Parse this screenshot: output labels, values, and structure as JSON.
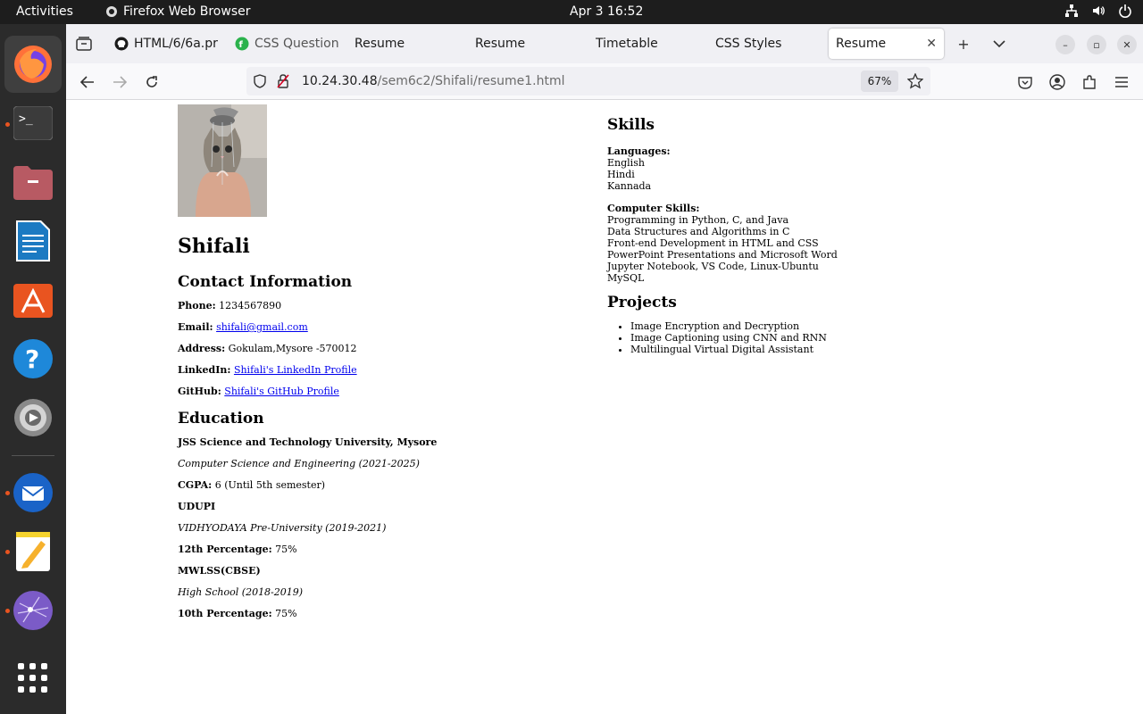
{
  "system": {
    "activities": "Activities",
    "app_name": "Firefox Web Browser",
    "clock": "Apr 3  16:52"
  },
  "browser": {
    "tabs": [
      {
        "label": "HTML/6/6a.pr",
        "icon": "github-icon"
      },
      {
        "label": "CSS Question",
        "icon": "quora-icon"
      },
      {
        "label": "Resume"
      },
      {
        "label": "Resume"
      },
      {
        "label": "Timetable"
      },
      {
        "label": "CSS Styles"
      },
      {
        "label": "Resume",
        "active": true
      }
    ],
    "url_host": "10.24.30.48",
    "url_path": "/sem6c2/Shifali/resume1.html",
    "zoom": "67%"
  },
  "resume": {
    "name": "Shifali",
    "contact_heading": "Contact Information",
    "phone_label": "Phone:",
    "phone": "1234567890",
    "email_label": "Email:",
    "email": "shifali@gmail.com",
    "address_label": "Address:",
    "address": "Gokulam,Mysore -570012",
    "linkedin_label": "LinkedIn:",
    "linkedin": "Shifali's LinkedIn Profile",
    "github_label": "GitHub:",
    "github": "Shifali's GitHub Profile",
    "education_heading": "Education",
    "education": [
      {
        "school": "JSS Science and Technology University, Mysore",
        "course": "Computer Science and Engineering (2021-2025)",
        "score_label": "CGPA:",
        "score": "6 (Until 5th semester)"
      },
      {
        "school": "UDUPI",
        "course": "VIDHYODAYA Pre-University (2019-2021)",
        "score_label": "12th Percentage:",
        "score": "75%"
      },
      {
        "school": "MWLSS(CBSE)",
        "course": "High School (2018-2019)",
        "score_label": "10th Percentage:",
        "score": "75%"
      }
    ],
    "skills_heading": "Skills",
    "languages_label": "Languages:",
    "languages": [
      "English",
      "Hindi",
      "Kannada"
    ],
    "computer_skills_label": "Computer Skills:",
    "computer_skills": [
      "Programming in Python, C, and Java",
      "Data Structures and Algorithms in C",
      "Front-end Development in HTML and CSS",
      "PowerPoint Presentations and Microsoft Word",
      "Jupyter Notebook, VS Code, Linux-Ubuntu",
      "MySQL"
    ],
    "projects_heading": "Projects",
    "projects": [
      "Image Encryption and Decryption",
      "Image Captioning using CNN and RNN",
      "Multilingual Virtual Digital Assistant"
    ]
  },
  "colors": {
    "topbar": "#1d1d1d",
    "dock": "#2b2b2b",
    "link": "#0000ee",
    "ubuntu_orange": "#e95420"
  }
}
